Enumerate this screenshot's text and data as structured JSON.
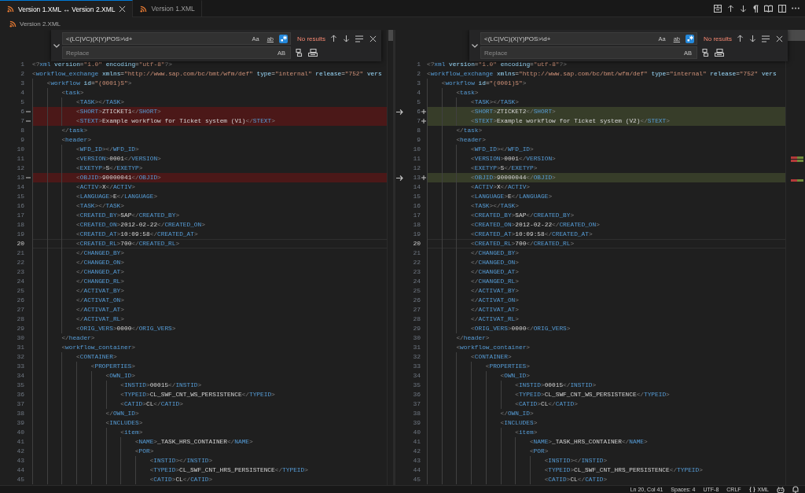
{
  "tabs": [
    {
      "label": "Version 1.XML ↔ Version 2.XML",
      "selected": true,
      "closable": true
    },
    {
      "label": "Version 1.XML",
      "selected": false,
      "closable": false
    }
  ],
  "breadcrumb": [
    "Version 2.XML"
  ],
  "panes": [
    {
      "kind": "original",
      "find": {
        "value": "<(LC|VC)(X|Y)POS>\\d+",
        "options": [
          {
            "kind": "text",
            "label": "Aa",
            "on": false
          },
          {
            "kind": "underlined",
            "label": "ab",
            "on": false
          },
          {
            "kind": "regex",
            "on": true
          }
        ],
        "result": "No results",
        "replace_expanded": true,
        "replace_placeholder": "Replace",
        "preserve_case": "AB"
      },
      "lines": [
        {
          "number": "1",
          "text": "<?xml version=\"1.0\" encoding=\"utf-8\"?>",
          "changed": false,
          "current": false
        },
        {
          "number": "2",
          "text": "<workflow_exchange xmlns=\"http://www.sap.com/bc/bmt/wfm/def\" type=\"internal\" release=\"752\" vers",
          "changed": false,
          "current": false
        },
        {
          "number": "3",
          "text": "    <workflow id=\"(0001)S\">",
          "changed": false,
          "current": false
        },
        {
          "number": "4",
          "text": "        <task>",
          "changed": false,
          "current": false
        },
        {
          "number": "5",
          "text": "            <TASK></TASK>",
          "changed": false,
          "current": false
        },
        {
          "number": "6",
          "text": "            <SHORT>ZTICKET1</SHORT>",
          "changed": true,
          "current": false
        },
        {
          "number": "7",
          "text": "            <STEXT>Example workflow for Ticket system (V1)</STEXT>",
          "changed": true,
          "current": false
        },
        {
          "number": "8",
          "text": "        </task>",
          "changed": false,
          "current": false
        },
        {
          "number": "9",
          "text": "        <header>",
          "changed": false,
          "current": false
        },
        {
          "number": "10",
          "text": "            <WFD_ID></WFD_ID>",
          "changed": false,
          "current": false
        },
        {
          "number": "11",
          "text": "            <VERSION>0001</VERSION>",
          "changed": false,
          "current": false
        },
        {
          "number": "12",
          "text": "            <EXETYP>S</EXETYP>",
          "changed": false,
          "current": false
        },
        {
          "number": "13",
          "text": "            <OBJID>90000041</OBJID>",
          "changed": true,
          "current": false
        },
        {
          "number": "14",
          "text": "            <ACTIV>X</ACTIV>",
          "changed": false,
          "current": false
        },
        {
          "number": "15",
          "text": "            <LANGUAGE>E</LANGUAGE>",
          "changed": false,
          "current": false
        },
        {
          "number": "16",
          "text": "            <TASK></TASK>",
          "changed": false,
          "current": false
        },
        {
          "number": "17",
          "text": "            <CREATED_BY>SAP</CREATED_BY>",
          "changed": false,
          "current": false
        },
        {
          "number": "18",
          "text": "            <CREATED_ON>2012-02-22</CREATED_ON>",
          "changed": false,
          "current": false
        },
        {
          "number": "19",
          "text": "            <CREATED_AT>10:09:58</CREATED_AT>",
          "changed": false,
          "current": false
        },
        {
          "number": "20",
          "text": "            <CREATED_RL>700</CREATED_RL>",
          "changed": false,
          "current": true
        },
        {
          "number": "21",
          "text": "            </CHANGED_BY>",
          "changed": false,
          "current": false
        },
        {
          "number": "22",
          "text": "            </CHANGED_ON>",
          "changed": false,
          "current": false
        },
        {
          "number": "23",
          "text": "            </CHANGED_AT>",
          "changed": false,
          "current": false
        },
        {
          "number": "24",
          "text": "            </CHANGED_RL>",
          "changed": false,
          "current": false
        },
        {
          "number": "25",
          "text": "            </ACTIVAT_BY>",
          "changed": false,
          "current": false
        },
        {
          "number": "26",
          "text": "            </ACTIVAT_ON>",
          "changed": false,
          "current": false
        },
        {
          "number": "27",
          "text": "            </ACTIVAT_AT>",
          "changed": false,
          "current": false
        },
        {
          "number": "28",
          "text": "            </ACTIVAT_RL>",
          "changed": false,
          "current": false
        },
        {
          "number": "29",
          "text": "            <ORIG_VERS>0000</ORIG_VERS>",
          "changed": false,
          "current": false
        },
        {
          "number": "30",
          "text": "        </header>",
          "changed": false,
          "current": false
        },
        {
          "number": "31",
          "text": "        <workflow_container>",
          "changed": false,
          "current": false
        },
        {
          "number": "32",
          "text": "            <CONTAINER>",
          "changed": false,
          "current": false
        },
        {
          "number": "33",
          "text": "                <PROPERTIES>",
          "changed": false,
          "current": false
        },
        {
          "number": "34",
          "text": "                    <OWN_ID>",
          "changed": false,
          "current": false
        },
        {
          "number": "35",
          "text": "                        <INSTID>00015</INSTID>",
          "changed": false,
          "current": false
        },
        {
          "number": "36",
          "text": "                        <TYPEID>CL_SWF_CNT_WS_PERSISTENCE</TYPEID>",
          "changed": false,
          "current": false
        },
        {
          "number": "37",
          "text": "                        <CATID>CL</CATID>",
          "changed": false,
          "current": false
        },
        {
          "number": "38",
          "text": "                    </OWN_ID>",
          "changed": false,
          "current": false
        },
        {
          "number": "39",
          "text": "                    <INCLUDES>",
          "changed": false,
          "current": false
        },
        {
          "number": "40",
          "text": "                        <item>",
          "changed": false,
          "current": false
        },
        {
          "number": "41",
          "text": "                            <NAME>_TASK_HRS_CONTAINER</NAME>",
          "changed": false,
          "current": false
        },
        {
          "number": "42",
          "text": "                            <POR>",
          "changed": false,
          "current": false
        },
        {
          "number": "43",
          "text": "                                <INSTID></INSTID>",
          "changed": false,
          "current": false
        },
        {
          "number": "44",
          "text": "                                <TYPEID>CL_SWF_CNT_HRS_PERSISTENCE</TYPEID>",
          "changed": false,
          "current": false
        },
        {
          "number": "45",
          "text": "                                <CATID>CL</CATID>",
          "changed": false,
          "current": false
        }
      ]
    },
    {
      "kind": "modified",
      "find": {
        "value": "<(LC|VC)(X|Y)POS>\\d+",
        "options": [
          {
            "kind": "text",
            "label": "Aa",
            "on": false
          },
          {
            "kind": "underlined",
            "label": "ab",
            "on": false
          },
          {
            "kind": "regex",
            "on": true
          }
        ],
        "result": "No results",
        "replace_expanded": true,
        "replace_placeholder": "Replace",
        "preserve_case": "AB"
      },
      "lines": [
        {
          "number": "1",
          "text": "<?xml version=\"1.0\" encoding=\"utf-8\"?>",
          "changed": false,
          "current": false
        },
        {
          "number": "2",
          "text": "<workflow_exchange xmlns=\"http://www.sap.com/bc/bmt/wfm/def\" type=\"internal\" release=\"752\" vers",
          "changed": false,
          "current": false
        },
        {
          "number": "3",
          "text": "    <workflow id=\"(0001)S\">",
          "changed": false,
          "current": false
        },
        {
          "number": "4",
          "text": "        <task>",
          "changed": false,
          "current": false
        },
        {
          "number": "5",
          "text": "            <TASK></TASK>",
          "changed": false,
          "current": false
        },
        {
          "number": "6",
          "text": "            <SHORT>ZTICKET2</SHORT>",
          "changed": true,
          "current": false
        },
        {
          "number": "7",
          "text": "            <STEXT>Example workflow for Ticket system (V2)</STEXT>",
          "changed": true,
          "current": false
        },
        {
          "number": "8",
          "text": "        </task>",
          "changed": false,
          "current": false
        },
        {
          "number": "9",
          "text": "        <header>",
          "changed": false,
          "current": false
        },
        {
          "number": "10",
          "text": "            <WFD_ID></WFD_ID>",
          "changed": false,
          "current": false
        },
        {
          "number": "11",
          "text": "            <VERSION>0001</VERSION>",
          "changed": false,
          "current": false
        },
        {
          "number": "12",
          "text": "            <EXETYP>S</EXETYP>",
          "changed": false,
          "current": false
        },
        {
          "number": "13",
          "text": "            <OBJID>90000044</OBJID>",
          "changed": true,
          "current": false
        },
        {
          "number": "14",
          "text": "            <ACTIV>X</ACTIV>",
          "changed": false,
          "current": false
        },
        {
          "number": "15",
          "text": "            <LANGUAGE>E</LANGUAGE>",
          "changed": false,
          "current": false
        },
        {
          "number": "16",
          "text": "            <TASK></TASK>",
          "changed": false,
          "current": false
        },
        {
          "number": "17",
          "text": "            <CREATED_BY>SAP</CREATED_BY>",
          "changed": false,
          "current": false
        },
        {
          "number": "18",
          "text": "            <CREATED_ON>2012-02-22</CREATED_ON>",
          "changed": false,
          "current": false
        },
        {
          "number": "19",
          "text": "            <CREATED_AT>10:09:58</CREATED_AT>",
          "changed": false,
          "current": false
        },
        {
          "number": "20",
          "text": "            <CREATED_RL>700</CREATED_RL>",
          "changed": false,
          "current": true
        },
        {
          "number": "21",
          "text": "            </CHANGED_BY>",
          "changed": false,
          "current": false
        },
        {
          "number": "22",
          "text": "            </CHANGED_ON>",
          "changed": false,
          "current": false
        },
        {
          "number": "23",
          "text": "            </CHANGED_AT>",
          "changed": false,
          "current": false
        },
        {
          "number": "24",
          "text": "            </CHANGED_RL>",
          "changed": false,
          "current": false
        },
        {
          "number": "25",
          "text": "            </ACTIVAT_BY>",
          "changed": false,
          "current": false
        },
        {
          "number": "26",
          "text": "            </ACTIVAT_ON>",
          "changed": false,
          "current": false
        },
        {
          "number": "27",
          "text": "            </ACTIVAT_AT>",
          "changed": false,
          "current": false
        },
        {
          "number": "28",
          "text": "            </ACTIVAT_RL>",
          "changed": false,
          "current": false
        },
        {
          "number": "29",
          "text": "            <ORIG_VERS>0000</ORIG_VERS>",
          "changed": false,
          "current": false
        },
        {
          "number": "30",
          "text": "        </header>",
          "changed": false,
          "current": false
        },
        {
          "number": "31",
          "text": "        <workflow_container>",
          "changed": false,
          "current": false
        },
        {
          "number": "32",
          "text": "            <CONTAINER>",
          "changed": false,
          "current": false
        },
        {
          "number": "33",
          "text": "                <PROPERTIES>",
          "changed": false,
          "current": false
        },
        {
          "number": "34",
          "text": "                    <OWN_ID>",
          "changed": false,
          "current": false
        },
        {
          "number": "35",
          "text": "                        <INSTID>00015</INSTID>",
          "changed": false,
          "current": false
        },
        {
          "number": "36",
          "text": "                        <TYPEID>CL_SWF_CNT_WS_PERSISTENCE</TYPEID>",
          "changed": false,
          "current": false
        },
        {
          "number": "37",
          "text": "                        <CATID>CL</CATID>",
          "changed": false,
          "current": false
        },
        {
          "number": "38",
          "text": "                    </OWN_ID>",
          "changed": false,
          "current": false
        },
        {
          "number": "39",
          "text": "                    <INCLUDES>",
          "changed": false,
          "current": false
        },
        {
          "number": "40",
          "text": "                        <item>",
          "changed": false,
          "current": false
        },
        {
          "number": "41",
          "text": "                            <NAME>_TASK_HRS_CONTAINER</NAME>",
          "changed": false,
          "current": false
        },
        {
          "number": "42",
          "text": "                            <POR>",
          "changed": false,
          "current": false
        },
        {
          "number": "43",
          "text": "                                <INSTID></INSTID>",
          "changed": false,
          "current": false
        },
        {
          "number": "44",
          "text": "                                <TYPEID>CL_SWF_CNT_HRS_PERSISTENCE</TYPEID>",
          "changed": false,
          "current": false
        },
        {
          "number": "45",
          "text": "                                <CATID>CL</CATID>",
          "changed": false,
          "current": false
        }
      ]
    }
  ],
  "status_bar": {
    "items": [
      {
        "kind": "plain",
        "text": "Ln 20, Col 41"
      },
      {
        "kind": "plain",
        "text": "Spaces: 4"
      },
      {
        "kind": "plain",
        "text": "UTF-8"
      },
      {
        "kind": "plain",
        "text": "CRLF"
      },
      {
        "kind": "language",
        "text": "XML"
      }
    ]
  }
}
